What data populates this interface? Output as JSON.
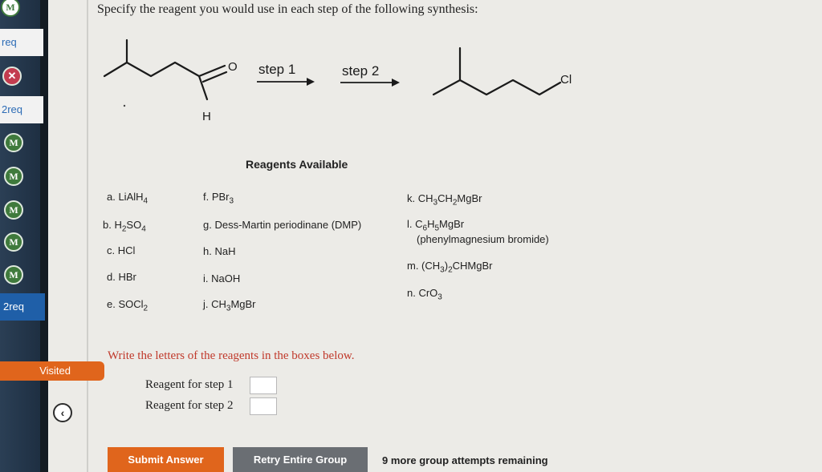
{
  "sidebar": {
    "items": [
      {
        "type": "badge",
        "label": "M"
      },
      {
        "type": "link",
        "label": "req"
      },
      {
        "type": "badge",
        "label": "✕"
      },
      {
        "type": "link",
        "label": "2req"
      },
      {
        "type": "badge",
        "label": "M"
      },
      {
        "type": "badge",
        "label": "M"
      },
      {
        "type": "badge",
        "label": "M"
      },
      {
        "type": "badge",
        "label": "M"
      },
      {
        "type": "badge",
        "label": "M"
      },
      {
        "type": "tab",
        "label": "2req"
      }
    ],
    "visited_label": "Visited",
    "collapse_icon": "‹"
  },
  "question": {
    "prompt": "Specify the reagent you would use in each step of the following synthesis:",
    "scheme": {
      "step1_label": "step 1",
      "step2_label": "step 2",
      "carbonyl_o": "O",
      "aldehyde_h": "H",
      "chloride_cl": "Cl"
    },
    "reagents_title": "Reagents Available",
    "reagents": {
      "a": {
        "prefix": "a. LiAlH",
        "sub": "4",
        "suffix": ""
      },
      "b": {
        "prefix": "b. H",
        "sub": "2",
        "mid": "SO",
        "sub2": "4"
      },
      "c": {
        "text": "c. HCl"
      },
      "d": {
        "text": "d. HBr"
      },
      "e": {
        "prefix": "e. SOCl",
        "sub": "2"
      },
      "f": {
        "prefix": "f. PBr",
        "sub": "3"
      },
      "g": {
        "text": "g. Dess-Martin periodinane (DMP)"
      },
      "h": {
        "text": "h. NaH"
      },
      "i": {
        "text": "i. NaOH"
      },
      "j": {
        "prefix": "j. CH",
        "sub": "3",
        "mid": "MgBr"
      },
      "k": {
        "prefix": "k. CH",
        "sub": "3",
        "mid": "CH",
        "sub2": "2",
        "mid2": "MgBr"
      },
      "l": {
        "prefix": "l. C",
        "sub": "6",
        "mid": "H",
        "sub2": "5",
        "mid2": "MgBr",
        "note": "(phenylmagnesium bromide)"
      },
      "m": {
        "prefix": "m. (CH",
        "sub": "3",
        "mid": ")",
        "sub2": "2",
        "mid2": "CHMgBr"
      },
      "n": {
        "prefix": "n. CrO",
        "sub": "3"
      }
    },
    "instructions": "Write the letters of the reagents in the boxes below.",
    "step1_prompt": "Reagent for step 1",
    "step2_prompt": "Reagent for step 2",
    "step1_value": "",
    "step2_value": ""
  },
  "actions": {
    "submit_label": "Submit Answer",
    "retry_label": "Retry Entire Group",
    "attempts_text": "9 more group attempts remaining"
  },
  "colors": {
    "accent_orange": "#e0651c",
    "badge_green": "#3f7a3c",
    "badge_red": "#c33c4f",
    "instruction_red": "#c0392b",
    "link_blue": "#2d6cb6"
  }
}
